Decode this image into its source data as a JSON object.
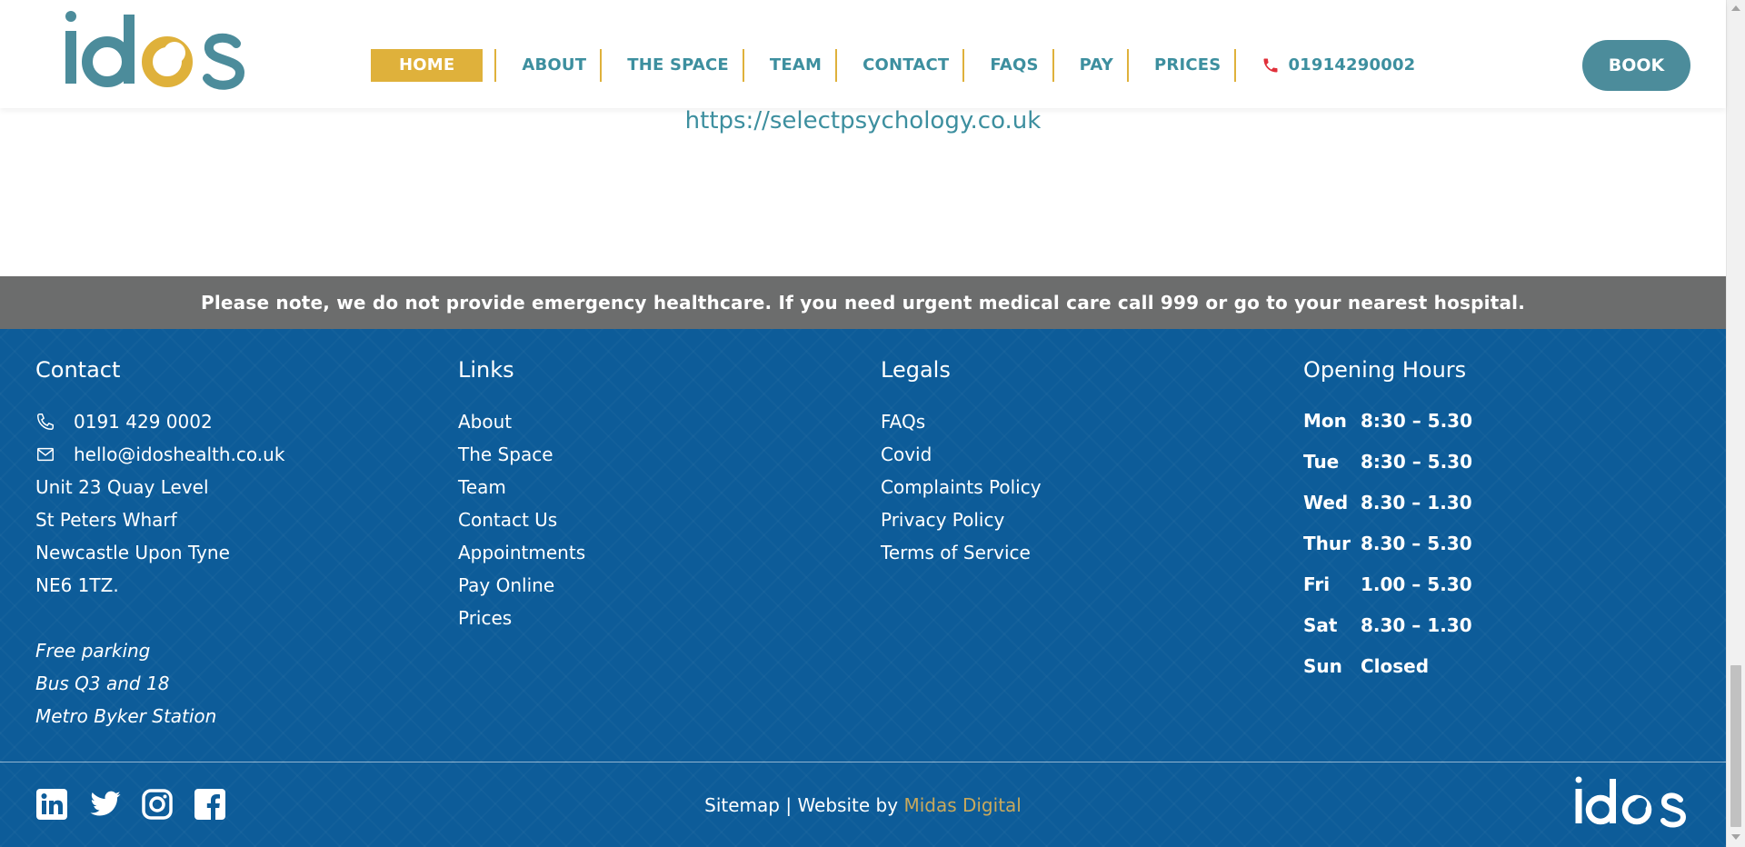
{
  "header": {
    "logo_text": "idos",
    "nav": [
      {
        "label": "HOME",
        "active": true
      },
      {
        "label": "ABOUT"
      },
      {
        "label": "THE SPACE"
      },
      {
        "label": "TEAM"
      },
      {
        "label": "CONTACT"
      },
      {
        "label": "FAQS"
      },
      {
        "label": "PAY"
      },
      {
        "label": "PRICES"
      }
    ],
    "phone": "01914290002",
    "book_label": "BOOK"
  },
  "content": {
    "url_text": "https://selectpsychology.co.uk"
  },
  "notice": "Please note, we do not provide emergency healthcare. If you need urgent medical care call 999 or go to your nearest hospital.",
  "footer": {
    "contact": {
      "title": "Contact",
      "phone": "0191 429 0002",
      "email": "hello@idoshealth.co.uk",
      "address": [
        "Unit 23 Quay Level",
        "St Peters Wharf",
        "Newcastle Upon Tyne",
        "NE6 1TZ."
      ],
      "transport": [
        "Free parking",
        "Bus Q3 and 18",
        "Metro Byker Station"
      ]
    },
    "links": {
      "title": "Links",
      "items": [
        "About",
        "The Space",
        "Team",
        "Contact Us",
        "Appointments",
        "Pay Online",
        "Prices"
      ]
    },
    "legals": {
      "title": "Legals",
      "items": [
        "FAQs",
        "Covid",
        "Complaints Policy",
        "Privacy Policy",
        "Terms of Service"
      ]
    },
    "hours": {
      "title": "Opening Hours",
      "rows": [
        {
          "day": "Mon",
          "time": "8:30 – 5.30"
        },
        {
          "day": "Tue",
          "time": "8:30 – 5.30"
        },
        {
          "day": "Wed",
          "time": "8.30 – 1.30"
        },
        {
          "day": "Thur",
          "time": "8.30 – 5.30"
        },
        {
          "day": "Fri",
          "time": "1.00 – 5.30"
        },
        {
          "day": "Sat",
          "time": "8.30 – 1.30"
        },
        {
          "day": "Sun",
          "time": "Closed"
        }
      ]
    },
    "social": [
      "linkedin-icon",
      "twitter-icon",
      "instagram-icon",
      "facebook-icon"
    ],
    "sitemap": "Sitemap",
    "separator": "|",
    "website_by": "Website by",
    "agency": "Midas Digital",
    "logo_text": "idos"
  },
  "colors": {
    "teal": "#3d8f9f",
    "gold": "#dfb13b",
    "footer_blue": "#0d5c99",
    "notice_grey": "#6c6d6d",
    "book_teal": "#4c8c9b"
  }
}
